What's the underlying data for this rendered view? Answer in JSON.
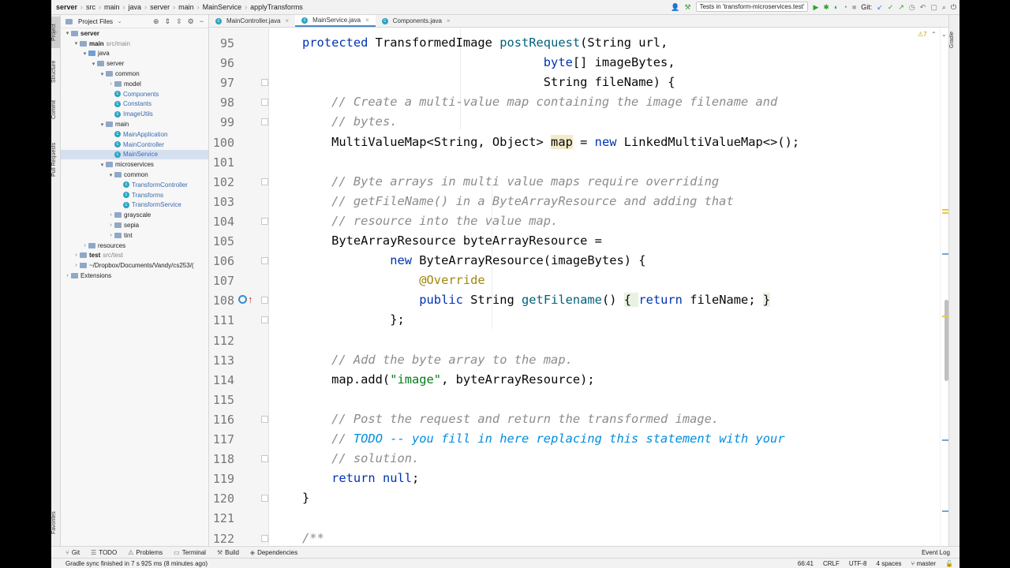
{
  "breadcrumbs": [
    "server",
    "src",
    "main",
    "java",
    "server",
    "main",
    "MainService",
    "applyTransforms"
  ],
  "run_config": "Tests in 'transform-microservices.test'",
  "vcs_label": "Git:",
  "left_strip": [
    "Project",
    "Structure",
    "Commit",
    "Pull Requests",
    "Favorites"
  ],
  "right_strip": [
    "Gradle"
  ],
  "project_panel": {
    "title": "Project Files",
    "tree": [
      {
        "indent": 0,
        "arrow": "▾",
        "icon": "folder",
        "label": "server",
        "bold": true
      },
      {
        "indent": 1,
        "arrow": "▾",
        "icon": "folder",
        "label": "main",
        "extra": "src/main",
        "bold": true
      },
      {
        "indent": 2,
        "arrow": "▾",
        "icon": "folder-blue",
        "label": "java"
      },
      {
        "indent": 3,
        "arrow": "▾",
        "icon": "folder",
        "label": "server"
      },
      {
        "indent": 4,
        "arrow": "▾",
        "icon": "folder",
        "label": "common"
      },
      {
        "indent": 5,
        "arrow": "›",
        "icon": "folder",
        "label": "model"
      },
      {
        "indent": 5,
        "arrow": "",
        "icon": "class",
        "label": "Components",
        "cname": true
      },
      {
        "indent": 5,
        "arrow": "",
        "icon": "class",
        "label": "Constants",
        "cname": true
      },
      {
        "indent": 5,
        "arrow": "",
        "icon": "class",
        "label": "ImageUtils",
        "cname": true
      },
      {
        "indent": 4,
        "arrow": "▾",
        "icon": "folder",
        "label": "main"
      },
      {
        "indent": 5,
        "arrow": "",
        "icon": "class",
        "label": "MainApplication",
        "cname": true
      },
      {
        "indent": 5,
        "arrow": "",
        "icon": "class",
        "label": "MainController",
        "cname": true
      },
      {
        "indent": 5,
        "arrow": "",
        "icon": "class",
        "label": "MainService",
        "cname": true,
        "selected": true
      },
      {
        "indent": 4,
        "arrow": "▾",
        "icon": "folder",
        "label": "microservices"
      },
      {
        "indent": 5,
        "arrow": "▾",
        "icon": "folder",
        "label": "common"
      },
      {
        "indent": 6,
        "arrow": "",
        "icon": "class",
        "label": "TransformController",
        "cname": true
      },
      {
        "indent": 6,
        "arrow": "",
        "icon": "class",
        "label": "Transforms",
        "cname": true
      },
      {
        "indent": 6,
        "arrow": "",
        "icon": "class",
        "label": "TransformService",
        "cname": true
      },
      {
        "indent": 5,
        "arrow": "›",
        "icon": "folder",
        "label": "grayscale"
      },
      {
        "indent": 5,
        "arrow": "›",
        "icon": "folder",
        "label": "sepia"
      },
      {
        "indent": 5,
        "arrow": "›",
        "icon": "folder",
        "label": "tint"
      },
      {
        "indent": 2,
        "arrow": "›",
        "icon": "folder",
        "label": "resources"
      },
      {
        "indent": 1,
        "arrow": "›",
        "icon": "folder",
        "label": "test",
        "extra": "src/test",
        "bold": true
      },
      {
        "indent": 1,
        "arrow": "›",
        "icon": "folder",
        "label": "~/Dropbox/Documents/Vandy/cs253/("
      },
      {
        "indent": 0,
        "arrow": "›",
        "icon": "folder",
        "label": "Extensions"
      }
    ]
  },
  "tabs": [
    {
      "label": "MainController.java",
      "active": false
    },
    {
      "label": "MainService.java",
      "active": true
    },
    {
      "label": "Components.java",
      "active": false
    }
  ],
  "editor": {
    "warning_count": "7",
    "lines": [
      {
        "num": "95",
        "html": "<span class=\"kw\">protected</span> TransformedImage <span class=\"fn\">postRequest</span>(String url,",
        "fold": false
      },
      {
        "num": "96",
        "html": "                                 <span class=\"kw\">byte</span>[] imageBytes,",
        "fold": false
      },
      {
        "num": "97",
        "html": "                                 String fileName) {",
        "fold": true
      },
      {
        "num": "98",
        "html": "    <span class=\"cm\">// Create a multi-value map containing the image filename and</span>",
        "fold": true
      },
      {
        "num": "99",
        "html": "    <span class=\"cm\">// bytes.</span>",
        "fold": true
      },
      {
        "num": "100",
        "html": "    MultiValueMap&lt;String, Object&gt; <span class=\"hl\">map</span> = <span class=\"kw\">new</span> LinkedMultiValueMap&lt;&gt;();",
        "fold": false
      },
      {
        "num": "101",
        "html": "",
        "fold": false
      },
      {
        "num": "102",
        "html": "    <span class=\"cm\">// Byte arrays in multi value maps require overriding</span>",
        "fold": true
      },
      {
        "num": "103",
        "html": "    <span class=\"cm\">// getFileName() in a ByteArrayResource and adding that</span>",
        "fold": false
      },
      {
        "num": "104",
        "html": "    <span class=\"cm\">// resource into the value map.</span>",
        "fold": true
      },
      {
        "num": "105",
        "html": "    ByteArrayResource byteArrayResource =",
        "fold": false
      },
      {
        "num": "106",
        "html": "            <span class=\"kw\">new</span> ByteArrayResource(imageBytes) {",
        "fold": true
      },
      {
        "num": "107",
        "html": "                <span class=\"ann\">@Override</span>",
        "fold": false
      },
      {
        "num": "108",
        "html": "                <span class=\"kw\">public</span> String <span class=\"fn\">getFilename</span>() <span class=\"gbg\">{ </span><span class=\"kw\">return</span> fileName; <span class=\"gbg\">}</span>",
        "fold": true,
        "glyph": true
      },
      {
        "num": "111",
        "html": "            };",
        "fold": true
      },
      {
        "num": "112",
        "html": "",
        "fold": false
      },
      {
        "num": "113",
        "html": "    <span class=\"cm\">// Add the byte array to the map.</span>",
        "fold": false
      },
      {
        "num": "114",
        "html": "    map.add(<span class=\"str\">\"image\"</span>, byteArrayResource);",
        "fold": false
      },
      {
        "num": "115",
        "html": "",
        "fold": false
      },
      {
        "num": "116",
        "html": "    <span class=\"cm\">// Post the request and return the transformed image.</span>",
        "fold": true
      },
      {
        "num": "117",
        "html": "    <span class=\"cm\">// </span><span class=\"todo\">TODO -- you fill in here replacing this statement with your</span>",
        "fold": false
      },
      {
        "num": "118",
        "html": "    <span class=\"cm\">// solution.</span>",
        "fold": true
      },
      {
        "num": "119",
        "html": "    <span class=\"kw\">return null</span>;",
        "fold": false
      },
      {
        "num": "120",
        "html": "}",
        "fold": true
      },
      {
        "num": "121",
        "html": "",
        "fold": false
      },
      {
        "num": "122",
        "html": "<span class=\"cm\">/**</span>",
        "fold": true
      }
    ]
  },
  "bottom_tools": [
    "Git",
    "TODO",
    "Problems",
    "Terminal",
    "Build",
    "Dependencies"
  ],
  "event_log": "Event Log",
  "status": {
    "message": "Gradle sync finished in 7 s 925 ms (8 minutes ago)",
    "position": "66:41",
    "line_sep": "CRLF",
    "encoding": "UTF-8",
    "indent": "4 spaces",
    "branch": "master"
  },
  "colors": {
    "accent": "#4a88c7",
    "keyword": "#0033b3",
    "comment": "#8c8c8c",
    "todo": "#008dde",
    "string": "#067d17"
  }
}
